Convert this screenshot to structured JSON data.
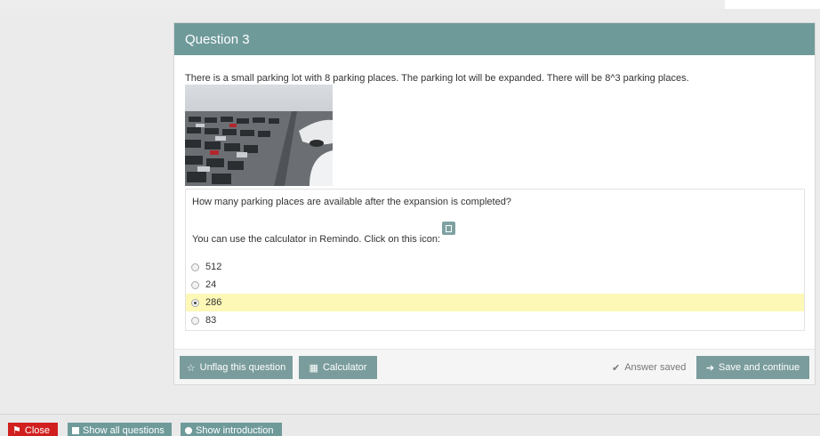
{
  "question": {
    "title": "Question 3",
    "stem": "There is a small parking lot with 8 parking places. The parking lot will be expanded. There will be 8^3 parking places.",
    "prompt": "How many parking places are available after the expansion is completed?",
    "calculator_hint": "You can use the calculator in Remindo. Click on this icon:",
    "options": [
      "512",
      "24",
      "286",
      "83"
    ],
    "selected_index": 2
  },
  "footer": {
    "unflag_label": "Unflag this question",
    "calculator_label": "Calculator",
    "saved_status": "Answer saved",
    "save_continue_label": "Save and continue"
  },
  "bottom_bar": {
    "close_label": "Close",
    "show_all_label": "Show all questions",
    "show_intro_label": "Show introduction"
  },
  "colors": {
    "header": "#6f9a9a",
    "button": "#7a9c9c",
    "close": "#d11f1f",
    "selected_row": "#fdf8b6"
  },
  "icons": [
    "star-icon",
    "calculator-icon",
    "checkmark-icon",
    "arrow-right-icon",
    "flag-icon",
    "list-icon",
    "info-icon"
  ]
}
